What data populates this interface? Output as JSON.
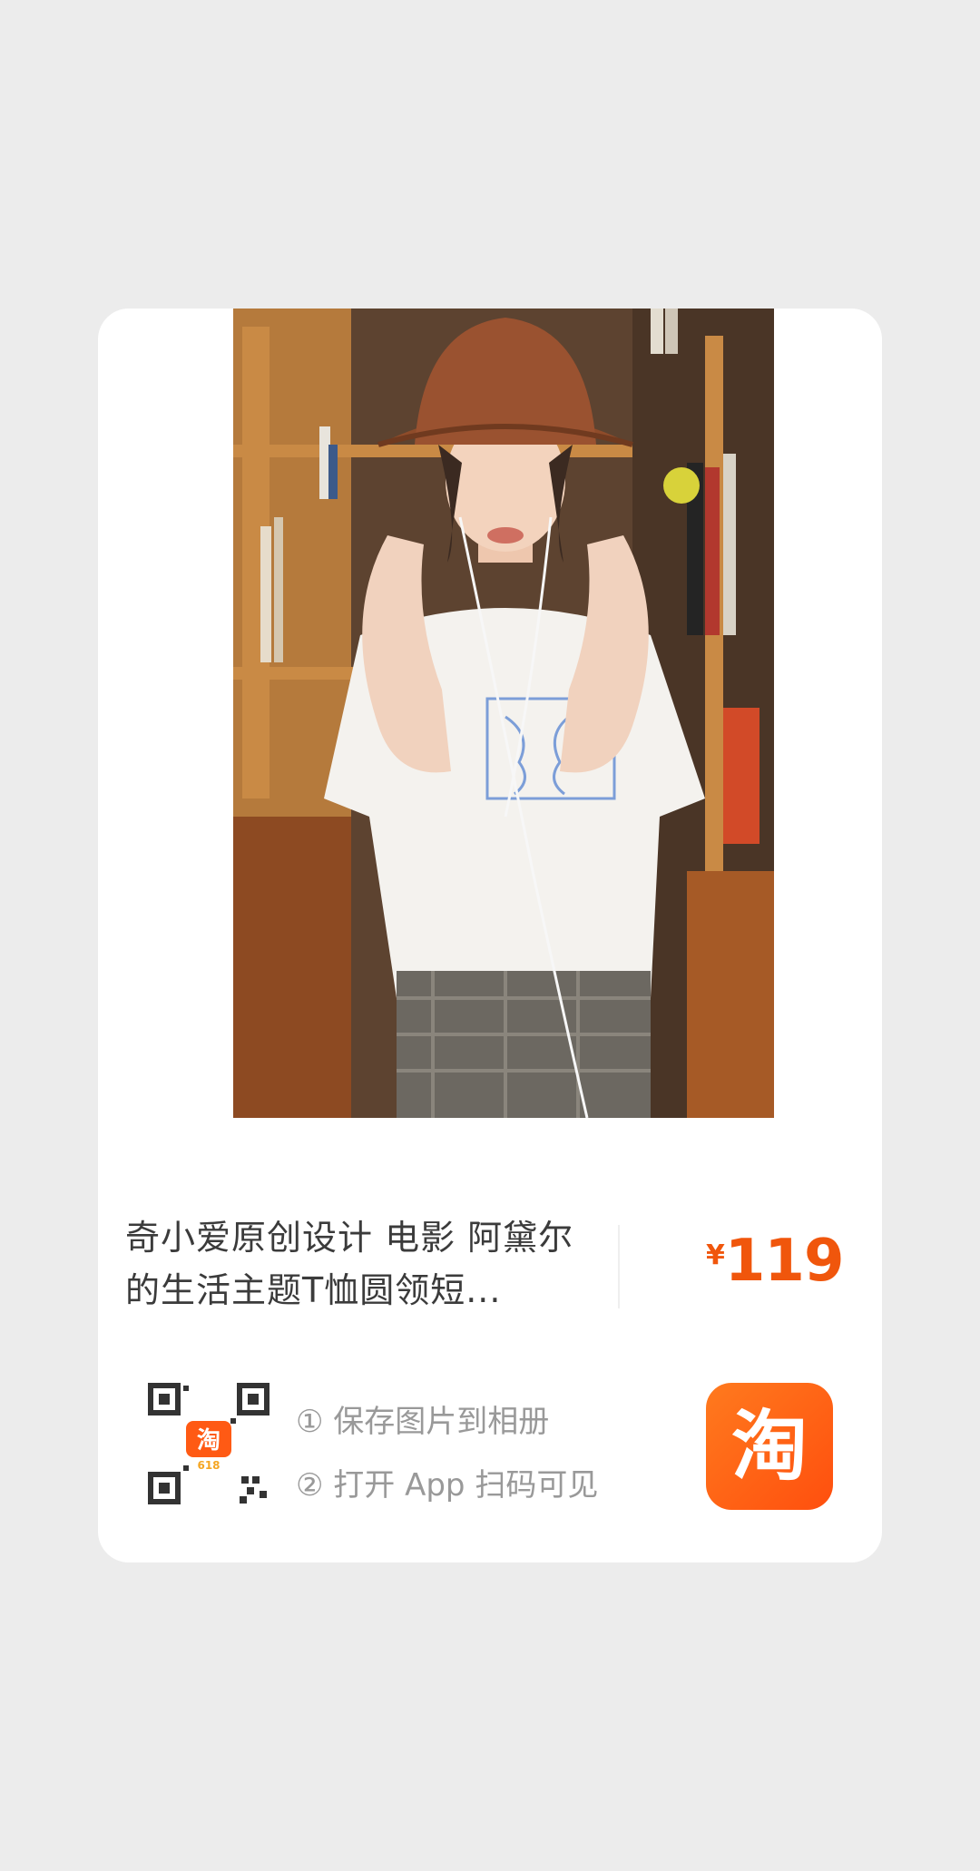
{
  "product": {
    "title": "奇小爱原创设计 电影 阿黛尔的生活主题T恤圆领短...",
    "currency_symbol": "¥",
    "price": "119",
    "photo_icon": "product-photo"
  },
  "qr_badge": {
    "label": "淘",
    "sub": "618"
  },
  "instructions": {
    "step1": "① 保存图片到相册",
    "step2": "② 打开 App 扫码可见"
  },
  "app_logo": {
    "label": "淘"
  },
  "colors": {
    "accent": "#f0560c",
    "background": "#ececec",
    "card": "#ffffff",
    "logo_start": "#ff7a1e",
    "logo_end": "#ff4f0e"
  }
}
